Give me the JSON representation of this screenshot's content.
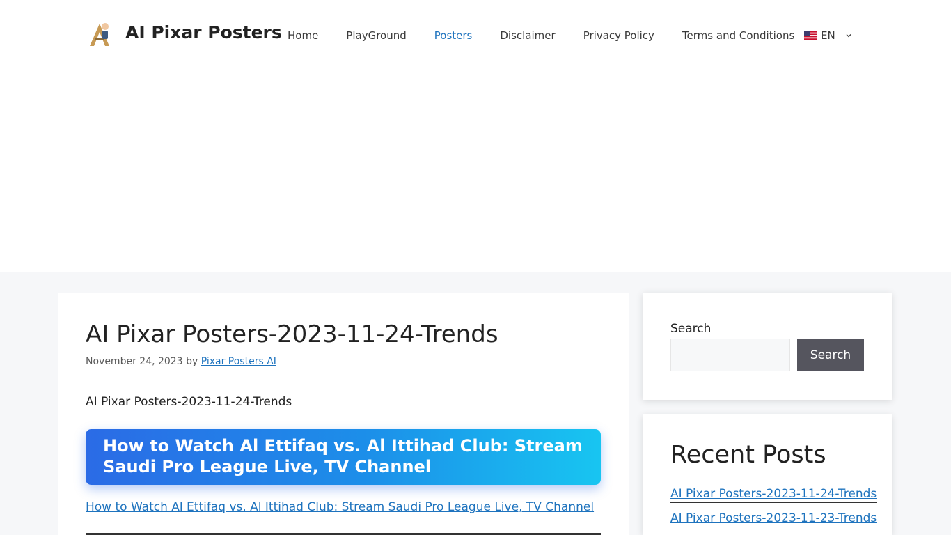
{
  "header": {
    "site_title": "AI Pixar Posters",
    "logo_icon": "pixar-a-logo-icon",
    "nav": [
      {
        "label": "Home"
      },
      {
        "label": "PlayGround"
      },
      {
        "label": "Posters",
        "current": true
      },
      {
        "label": "Disclaimer"
      },
      {
        "label": "Privacy Policy"
      },
      {
        "label": "Terms and Conditions"
      }
    ],
    "language": {
      "label": "EN",
      "flag_icon": "us-flag-icon",
      "caret_icon": "chevron-down-icon"
    }
  },
  "post": {
    "title": "AI Pixar Posters-2023-11-24-Trends",
    "date": "November 24, 2023",
    "by": "by",
    "author": "Pixar Posters AI",
    "intro": "AI Pixar Posters-2023-11-24-Trends",
    "banner_text": "How to Watch Al Ettifaq vs. Al Ittihad Club: Stream Saudi Pro League Live, TV Channel",
    "link_text": "How to Watch Al Ettifaq vs. Al Ittihad Club: Stream Saudi Pro League Live, TV Channel"
  },
  "sidebar": {
    "search": {
      "label": "Search",
      "placeholder": "",
      "button_label": "Search"
    },
    "recent": {
      "title": "Recent Posts",
      "items": [
        {
          "label": "AI Pixar Posters-2023-11-24-Trends"
        },
        {
          "label": "AI Pixar Posters-2023-11-23-Trends"
        }
      ]
    }
  },
  "colors": {
    "link": "#1e73be",
    "banner_start": "#2b6be6",
    "banner_end": "#18c5f1",
    "search_button": "#55555e",
    "page_background": "#f6f7f9"
  }
}
